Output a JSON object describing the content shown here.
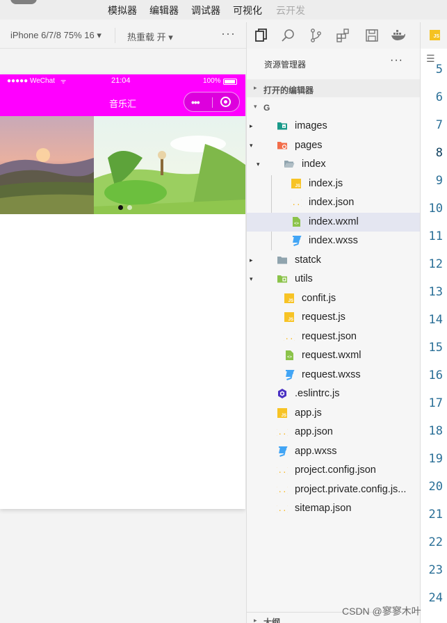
{
  "menubar": {
    "items": [
      "模拟器",
      "编辑器",
      "调试器",
      "可视化",
      "云开发"
    ]
  },
  "toolbar": {
    "device": "iPhone 6/7/8 75% 16 ▾",
    "hot_reload": "热重载 开 ▾",
    "more": "···"
  },
  "phone": {
    "status_signal": "●●●●● WeChat",
    "status_time": "21:04",
    "status_battery": "100%",
    "nav_title": "音乐汇",
    "nav_color": "#ff00ff",
    "swiper_dots": 2,
    "swiper_active": 0
  },
  "explorer": {
    "title": "资源管理器",
    "more": "···",
    "open_editors": "打开的编辑器",
    "project": "G",
    "outline": "大纲",
    "tree": [
      {
        "name": "images",
        "type": "folder-image",
        "depth": 1,
        "caret": "▸"
      },
      {
        "name": "pages",
        "type": "folder-pages",
        "depth": 1,
        "caret": "▾"
      },
      {
        "name": "index",
        "type": "folder-open",
        "depth": 2,
        "caret": "▾"
      },
      {
        "name": "index.js",
        "type": "js",
        "depth": 3
      },
      {
        "name": "index.json",
        "type": "json",
        "depth": 3
      },
      {
        "name": "index.wxml",
        "type": "wxml",
        "depth": 3,
        "selected": true
      },
      {
        "name": "index.wxss",
        "type": "wxss",
        "depth": 3
      },
      {
        "name": "statck",
        "type": "folder",
        "depth": 1,
        "caret": "▸"
      },
      {
        "name": "utils",
        "type": "folder-utils",
        "depth": 1,
        "caret": "▾"
      },
      {
        "name": "confit.js",
        "type": "js",
        "depth": 2
      },
      {
        "name": "request.js",
        "type": "js",
        "depth": 2
      },
      {
        "name": "request.json",
        "type": "json",
        "depth": 2
      },
      {
        "name": "request.wxml",
        "type": "wxml",
        "depth": 2
      },
      {
        "name": "request.wxss",
        "type": "wxss",
        "depth": 2
      },
      {
        "name": ".eslintrc.js",
        "type": "eslint",
        "depth": 1
      },
      {
        "name": "app.js",
        "type": "js",
        "depth": 1
      },
      {
        "name": "app.json",
        "type": "json",
        "depth": 1
      },
      {
        "name": "app.wxss",
        "type": "wxss",
        "depth": 1
      },
      {
        "name": "project.config.json",
        "type": "json",
        "depth": 1
      },
      {
        "name": "project.private.config.js...",
        "type": "json",
        "depth": 1
      },
      {
        "name": "sitemap.json",
        "type": "json",
        "depth": 1
      }
    ]
  },
  "editor": {
    "tab_icon": "JS",
    "line_numbers": [
      "5",
      "6",
      "7",
      "8",
      "9",
      "10",
      "11",
      "12",
      "13",
      "14",
      "15",
      "16",
      "17",
      "18",
      "19",
      "20",
      "21",
      "22",
      "23",
      "24"
    ],
    "current_line": "8"
  },
  "watermark": "CSDN @寥寥木叶"
}
